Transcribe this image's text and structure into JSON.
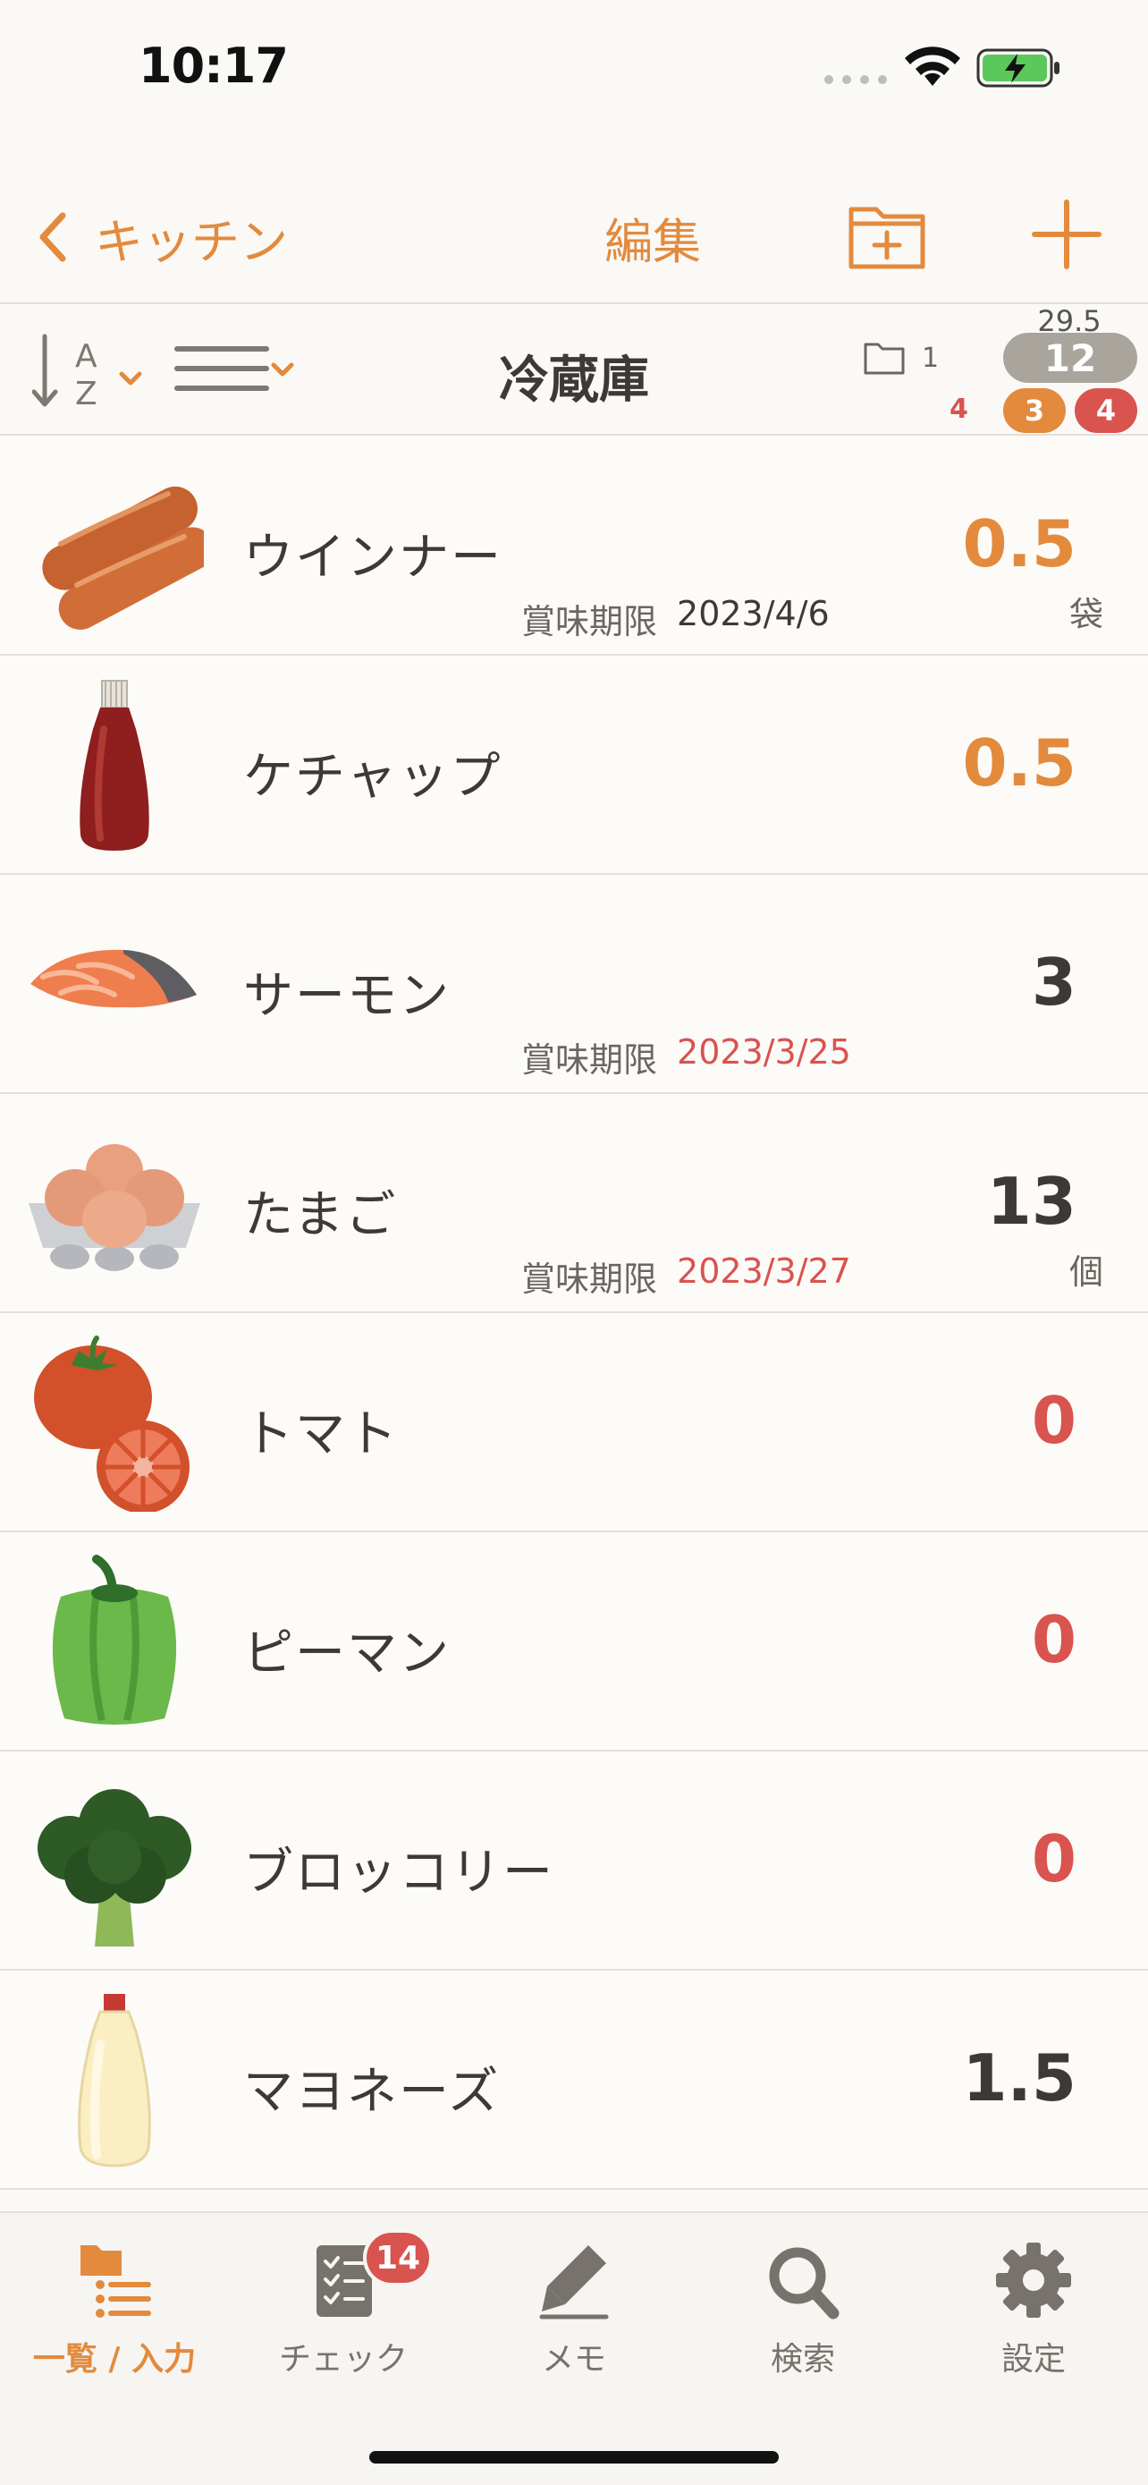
{
  "status_bar": {
    "time": "10:17"
  },
  "nav": {
    "back_label": "キッチン",
    "edit_label": "編集"
  },
  "sub_header": {
    "title": "冷蔵庫",
    "folder_count": "1",
    "total_amount": "29.5",
    "total_count": "12",
    "red_count_left": "4",
    "orange_badge": "3",
    "red_badge": "4"
  },
  "items": [
    {
      "name": "ウインナー",
      "qty": "0.5",
      "qty_color": "orange",
      "unit": "袋",
      "expiry_label": "賞味期限",
      "expiry_date": "2023/4/6",
      "expiry_color": "normal",
      "icon": "sausage-icon"
    },
    {
      "name": "ケチャップ",
      "qty": "0.5",
      "qty_color": "orange",
      "unit": "",
      "expiry_label": "",
      "expiry_date": "",
      "icon": "ketchup-icon"
    },
    {
      "name": "サーモン",
      "qty": "3",
      "qty_color": "dark",
      "unit": "",
      "expiry_label": "賞味期限",
      "expiry_date": "2023/3/25",
      "expiry_color": "red",
      "icon": "salmon-icon"
    },
    {
      "name": "たまご",
      "qty": "13",
      "qty_color": "dark",
      "unit": "個",
      "expiry_label": "賞味期限",
      "expiry_date": "2023/3/27",
      "expiry_color": "red",
      "icon": "egg-icon"
    },
    {
      "name": "トマト",
      "qty": "0",
      "qty_color": "red",
      "unit": "",
      "expiry_label": "",
      "expiry_date": "",
      "icon": "tomato-icon"
    },
    {
      "name": "ピーマン",
      "qty": "0",
      "qty_color": "red",
      "unit": "",
      "expiry_label": "",
      "expiry_date": "",
      "icon": "green-pepper-icon"
    },
    {
      "name": "ブロッコリー",
      "qty": "0",
      "qty_color": "red",
      "unit": "",
      "expiry_label": "",
      "expiry_date": "",
      "icon": "broccoli-icon"
    },
    {
      "name": "マヨネーズ",
      "qty": "1.5",
      "qty_color": "dark",
      "unit": "",
      "expiry_label": "",
      "expiry_date": "",
      "icon": "mayonnaise-icon"
    }
  ],
  "tabs": [
    {
      "label": "一覧 / 入力",
      "active": true,
      "icon": "list-icon"
    },
    {
      "label": "チェック",
      "badge": "14",
      "icon": "checklist-icon"
    },
    {
      "label": "メモ",
      "icon": "pencil-icon"
    },
    {
      "label": "検索",
      "icon": "search-icon"
    },
    {
      "label": "設定",
      "icon": "gear-icon"
    }
  ],
  "colors": {
    "accent": "#e38a3d",
    "alert": "#d9534f",
    "badge_gray": "#a9a59c"
  }
}
